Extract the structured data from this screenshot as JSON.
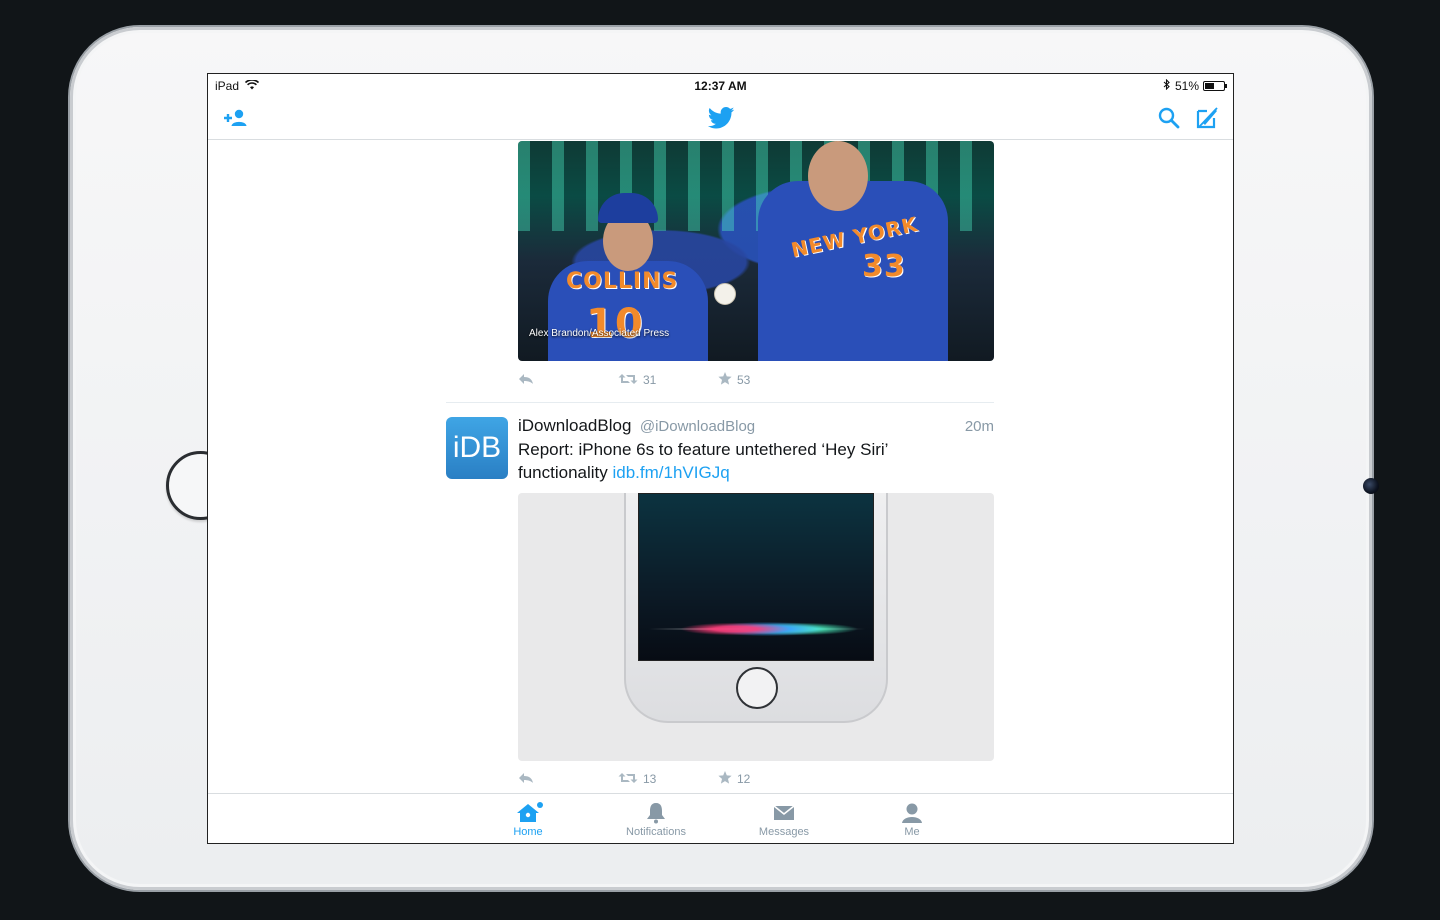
{
  "status_bar": {
    "device": "iPad",
    "time": "12:37 AM",
    "battery_percent": "51%",
    "battery_level": 0.51
  },
  "nav": {
    "add_user_icon": "add-user-icon",
    "logo_icon": "twitter-bird-icon",
    "search_icon": "search-icon",
    "compose_icon": "compose-icon"
  },
  "tweets": [
    {
      "photo_caption": "Alex Brandon/Associated Press",
      "jersey_text_1": "COLLINS",
      "jersey_number_1": "10",
      "jersey_text_2": "NEW YORK",
      "jersey_number_2": "33",
      "retweets": "31",
      "likes": "53"
    },
    {
      "avatar_text": "iDB",
      "name": "iDownloadBlog",
      "handle": "@iDownloadBlog",
      "time": "20m",
      "text": "Report: iPhone 6s to feature untethered ‘Hey Siri’ functionality ",
      "link": "idb.fm/1hVIGJq",
      "retweets": "13",
      "likes": "12"
    }
  ],
  "tabs": [
    {
      "label": "Home",
      "icon": "home-icon",
      "active": true
    },
    {
      "label": "Notifications",
      "icon": "bell-icon",
      "active": false
    },
    {
      "label": "Messages",
      "icon": "envelope-icon",
      "active": false
    },
    {
      "label": "Me",
      "icon": "person-icon",
      "active": false
    }
  ],
  "colors": {
    "accent": "#1da1f2",
    "muted": "#8899a6",
    "text": "#14171a"
  }
}
